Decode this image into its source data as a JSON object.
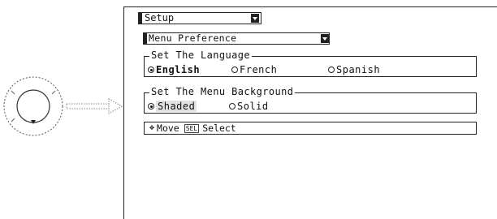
{
  "menu": {
    "title": "Setup",
    "submenu": "Menu Preference",
    "language_group": {
      "legend": "Set The Language",
      "options": [
        {
          "label": "English",
          "selected": true
        },
        {
          "label": "French",
          "selected": false
        },
        {
          "label": "Spanish",
          "selected": false
        }
      ]
    },
    "background_group": {
      "legend": "Set The Menu Background",
      "options": [
        {
          "label": "Shaded",
          "selected": true
        },
        {
          "label": "Solid",
          "selected": false
        }
      ]
    },
    "footer": {
      "move_label": "Move",
      "sel_key": "SEL",
      "select_label": "Select"
    }
  },
  "icons": {
    "remote": "remote-dpad-icon",
    "arrow": "right-arrow-icon",
    "move": "four-way-arrow-icon",
    "dropdown": "dropdown-arrow-icon"
  }
}
